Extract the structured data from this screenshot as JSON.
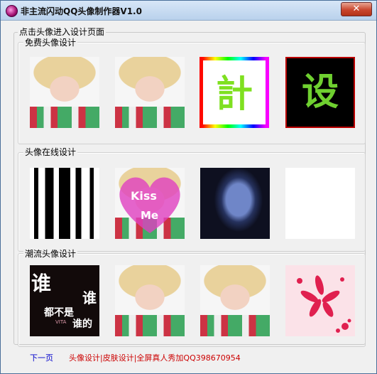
{
  "window": {
    "title": "非主流闪动QQ头像制作器V1.0",
    "close_label": "✕"
  },
  "main_group": {
    "label": "点击头像进入设计页面"
  },
  "sections": [
    {
      "label": "免费头像设计",
      "thumbs": [
        "photo",
        "photo",
        "calligraphy-ji",
        "calligraphy-she"
      ]
    },
    {
      "label": "头像在线设计",
      "thumbs": [
        "stripes",
        "kiss-heart",
        "dark-portrait",
        "blank"
      ]
    },
    {
      "label": "潮流头像设计",
      "thumbs": [
        "shui-text",
        "photo",
        "photo",
        "flower"
      ]
    }
  ],
  "thumb_text": {
    "ji": "計",
    "she": "设",
    "kiss": "Kiss",
    "me": "Me",
    "shui_big": "谁",
    "shui_side": "谁",
    "shui_mid": "都不是",
    "shui_end": "谁的",
    "vita": "VITA"
  },
  "footer": {
    "next_page": "下一页",
    "promo": "头像设计|皮肤设计|全屏真人秀加QQ398670954"
  },
  "colors": {
    "link_blue": "#0000cc",
    "promo_red": "#cc0000"
  }
}
